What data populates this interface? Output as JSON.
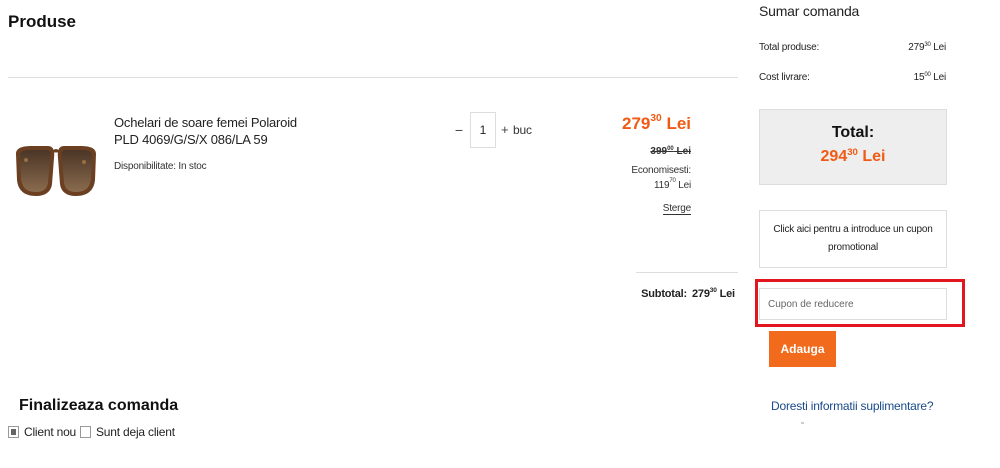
{
  "products": {
    "title": "Produse",
    "item": {
      "name": "Ochelari de soare femei Polaroid PLD 4069/G/S/X 086/LA 59",
      "availability": "Disponibilitate: In stoc",
      "quantity": "1",
      "minus_label": "−",
      "plus_label": "+",
      "unit": "buc",
      "price_new_int": "279",
      "price_new_dec": "30",
      "currency": "Lei",
      "price_old_int": "399",
      "price_old_dec": "00",
      "economisesti_label": "Economisesti:",
      "economisesti_int": "119",
      "economisesti_dec": "70",
      "delete_label": "Sterge"
    },
    "subtotal_label": "Subtotal:",
    "subtotal_int": "279",
    "subtotal_dec": "30"
  },
  "summary": {
    "title": "Sumar comanda",
    "total_produse_label": "Total produse:",
    "total_produse_int": "279",
    "total_produse_dec": "30",
    "cost_livrare_label": "Cost livrare:",
    "cost_livrare_int": "15",
    "cost_livrare_dec": "00",
    "total_label": "Total:",
    "total_int": "294",
    "total_dec": "30",
    "currency": "Lei",
    "coupon_toggle_text": "Click aici pentru a introduce un cupon promotional",
    "coupon_placeholder": "Cupon de reducere",
    "coupon_value": "",
    "add_button": "Adauga",
    "info_link": "Doresti informatii suplimentare?"
  },
  "checkout": {
    "title": "Finalizeaza comanda",
    "options": [
      {
        "label": "Client nou",
        "checked": true
      },
      {
        "label": "Sunt deja client",
        "checked": false
      }
    ]
  },
  "colors": {
    "accent": "#f05a14",
    "button": "#f26a1b",
    "highlight": "#e2161e",
    "link": "#1a4a8a"
  }
}
